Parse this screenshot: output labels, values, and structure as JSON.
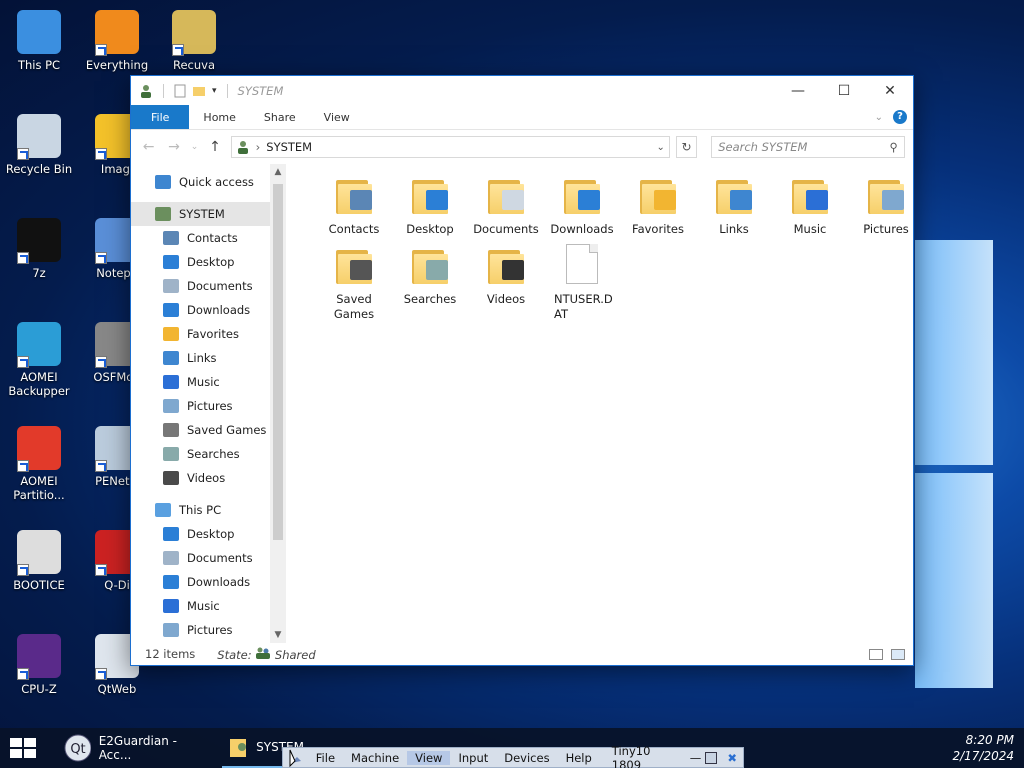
{
  "desktop": {
    "icons": [
      {
        "label": "This PC",
        "icon": "monitor-icon"
      },
      {
        "label": "Everything",
        "icon": "everything-search-icon"
      },
      {
        "label": "Recuva",
        "icon": "recuva-icon"
      },
      {
        "label": "Recycle Bin",
        "icon": "recycle-bin-icon"
      },
      {
        "label": "Imagi",
        "icon": "imagine-icon"
      },
      {
        "label": "7z",
        "icon": "7zip-icon"
      },
      {
        "label": "Notepa",
        "icon": "notepad-icon"
      },
      {
        "label": "AOMEI Backupper",
        "icon": "aomei-backupper-icon"
      },
      {
        "label": "OSFMou",
        "icon": "osfmount-icon"
      },
      {
        "label": "AOMEI Partitio...",
        "icon": "aomei-partition-icon"
      },
      {
        "label": "PENetw",
        "icon": "penetwork-icon"
      },
      {
        "label": "BOOTICE",
        "icon": "bootice-icon"
      },
      {
        "label": "Q-Di",
        "icon": "q-dir-icon"
      },
      {
        "label": "CPU-Z",
        "icon": "cpuz-icon"
      },
      {
        "label": "QtWeb",
        "icon": "qtweb-icon"
      }
    ]
  },
  "explorer": {
    "title": "SYSTEM",
    "ribbon_tabs": [
      "File",
      "Home",
      "Share",
      "View"
    ],
    "address": {
      "path": "SYSTEM"
    },
    "search": {
      "placeholder": "Search SYSTEM"
    },
    "nav": {
      "quick_access": "Quick access",
      "system": "SYSTEM",
      "system_children": [
        "Contacts",
        "Desktop",
        "Documents",
        "Downloads",
        "Favorites",
        "Links",
        "Music",
        "Pictures",
        "Saved Games",
        "Searches",
        "Videos"
      ],
      "this_pc": "This PC",
      "this_pc_children": [
        "Desktop",
        "Documents",
        "Downloads",
        "Music",
        "Pictures"
      ]
    },
    "items": [
      {
        "label": "Contacts",
        "type": "folder",
        "emblem": "contact-card-icon"
      },
      {
        "label": "Desktop",
        "type": "folder",
        "emblem": "desktop-icon"
      },
      {
        "label": "Documents",
        "type": "folder",
        "emblem": "document-icon"
      },
      {
        "label": "Downloads",
        "type": "folder",
        "emblem": "download-arrow-icon"
      },
      {
        "label": "Favorites",
        "type": "folder",
        "emblem": "star-icon"
      },
      {
        "label": "Links",
        "type": "folder",
        "emblem": "link-arrow-icon"
      },
      {
        "label": "Music",
        "type": "folder",
        "emblem": "music-note-icon"
      },
      {
        "label": "Pictures",
        "type": "folder",
        "emblem": "landscape-icon"
      },
      {
        "label": "Saved Games",
        "type": "folder",
        "emblem": "chess-piece-icon"
      },
      {
        "label": "Searches",
        "type": "folder",
        "emblem": "magnifier-icon"
      },
      {
        "label": "Videos",
        "type": "folder",
        "emblem": "film-icon"
      },
      {
        "label": "NTUSER.DAT",
        "type": "file",
        "emblem": "file-icon"
      }
    ],
    "status": {
      "count": "12 items",
      "state_label": "State:",
      "state_value": "Shared"
    }
  },
  "taskbar": {
    "buttons": [
      "E2Guardian - Acc...",
      "SYSTEM"
    ],
    "time": "8:20 PM",
    "date": "2/17/2024"
  },
  "vbox_menu": {
    "items": [
      "File",
      "Machine",
      "View",
      "Input",
      "Devices",
      "Help"
    ],
    "name": "Tiny10 1809"
  },
  "colors": {
    "accent": "#1979ca",
    "folder": "#f6cf6a"
  }
}
